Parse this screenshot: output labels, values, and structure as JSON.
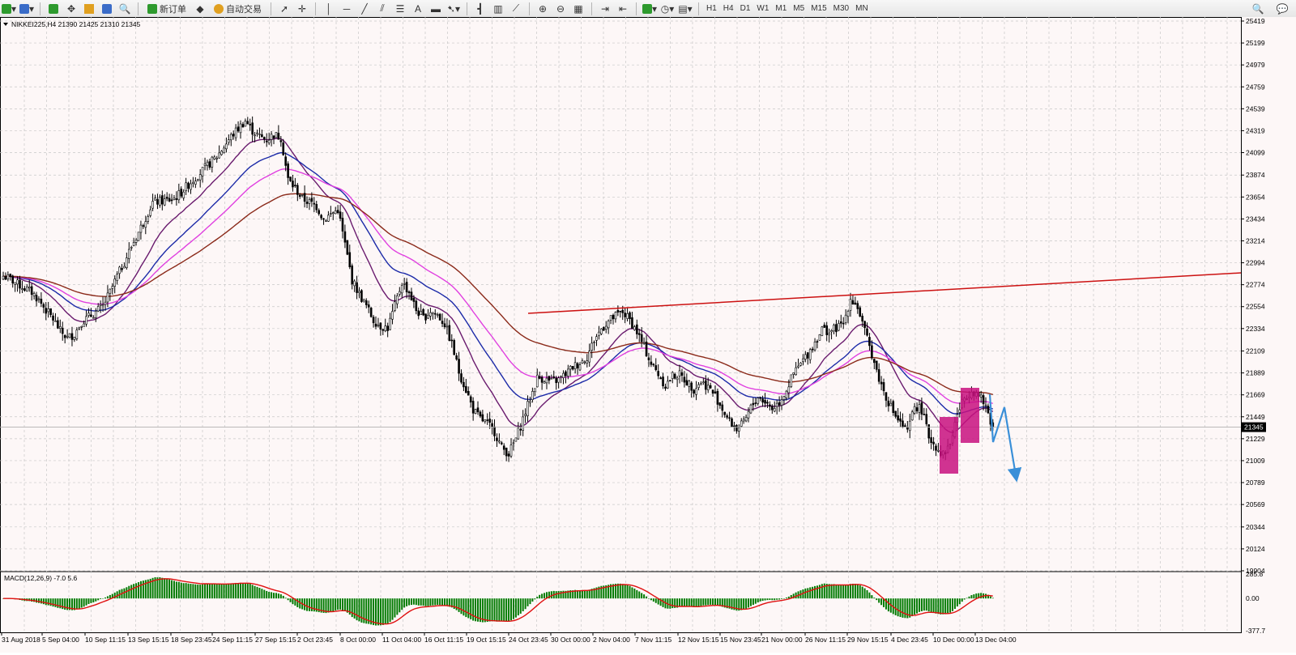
{
  "toolbar": {
    "new_order_label": "新订单",
    "auto_trading_label": "自动交易",
    "timeframes": [
      "H1",
      "H4",
      "D1",
      "W1",
      "M1",
      "M5",
      "M15",
      "M30",
      "MN"
    ],
    "icons": [
      "new-chart-icon",
      "profiles-icon",
      "market-watch-icon",
      "navigator-icon",
      "data-window-icon",
      "terminal-icon",
      "strategy-tester-icon",
      "new-order-icon",
      "meta-editor-icon",
      "auto-trading-icon",
      "cursor-icon",
      "crosshair-icon",
      "vertical-line-icon",
      "horizontal-line-icon",
      "trendline-icon",
      "equidistant-channel-icon",
      "fibonacci-icon",
      "text-icon",
      "label-icon",
      "arrows-icon",
      "bar-chart-icon",
      "candlestick-icon",
      "line-chart-icon",
      "zoom-in-icon",
      "zoom-out-icon",
      "tile-windows-icon",
      "chart-shift-icon",
      "autoscroll-icon",
      "indicators-icon",
      "periods-icon",
      "templates-icon",
      "search-icon",
      "chat-icon"
    ]
  },
  "chart": {
    "header": "NIKKEI225,H4  21390 21425 21310 21345",
    "price_ticks": [
      "25419",
      "25199",
      "24979",
      "24759",
      "24539",
      "24319",
      "24099",
      "23874",
      "23654",
      "23434",
      "23214",
      "22994",
      "22774",
      "22554",
      "22334",
      "22109",
      "21889",
      "21669",
      "21449",
      "21229",
      "21009",
      "20789",
      "20569",
      "20344",
      "20124",
      "19904"
    ],
    "current_price": "21345",
    "time_ticks": [
      "31 Aug 2018",
      "5 Sep 04:00",
      "10 Sep 11:15",
      "13 Sep 15:15",
      "18 Sep 23:45",
      "24 Sep 11:15",
      "27 Sep 15:15",
      "2 Oct 23:45",
      "8 Oct 00:00",
      "11 Oct 04:00",
      "16 Oct 11:15",
      "19 Oct 15:15",
      "24 Oct 23:45",
      "30 Oct 00:00",
      "2 Nov 04:00",
      "7 Nov 11:15",
      "12 Nov 15:15",
      "15 Nov 23:45",
      "21 Nov 00:00",
      "26 Nov 11:15",
      "29 Nov 15:15",
      "4 Dec 23:45",
      "10 Dec 00:00",
      "13 Dec 04:00"
    ],
    "macd_label": "MACD(12,26,9) -7.0 5.6",
    "macd_ticks": [
      "285.8",
      "0.00",
      "-377.7"
    ],
    "colors": {
      "background": "#fdf7f7",
      "grid": "#c8c8c8",
      "candle": "#000000",
      "ma_purple": "#6a1b6e",
      "ma_blue": "#1c2aa8",
      "ma_magenta": "#e040e0",
      "ma_brown": "#8b2a1a",
      "trendline": "#cc1111",
      "box": "#c8107f",
      "arrow": "#3a8fd8",
      "histogram": "#007a00",
      "signal": "#e01010"
    }
  },
  "chart_data": {
    "type": "candlestick",
    "symbol": "NIKKEI225",
    "timeframe": "H4",
    "last_bar": {
      "open": 21390,
      "high": 21425,
      "low": 21310,
      "close": 21345
    },
    "ylim": [
      19904,
      25419
    ],
    "x_time_labels": [
      "31 Aug 2018",
      "5 Sep 04:00",
      "10 Sep 11:15",
      "13 Sep 15:15",
      "18 Sep 23:45",
      "24 Sep 11:15",
      "27 Sep 15:15",
      "2 Oct 23:45",
      "8 Oct 00:00",
      "11 Oct 04:00",
      "16 Oct 11:15",
      "19 Oct 15:15",
      "24 Oct 23:45",
      "30 Oct 00:00",
      "2 Nov 04:00",
      "7 Nov 11:15",
      "12 Nov 15:15",
      "15 Nov 23:45",
      "21 Nov 00:00",
      "26 Nov 11:15",
      "29 Nov 15:15",
      "4 Dec 23:45",
      "10 Dec 00:00",
      "13 Dec 04:00"
    ],
    "close_path": [
      [
        0,
        22860
      ],
      [
        3,
        22830
      ],
      [
        6,
        22780
      ],
      [
        9,
        22740
      ],
      [
        12,
        22700
      ],
      [
        15,
        22620
      ],
      [
        18,
        22520
      ],
      [
        21,
        22430
      ],
      [
        24,
        22310
      ],
      [
        27,
        22240
      ],
      [
        30,
        22280
      ],
      [
        33,
        22400
      ],
      [
        36,
        22450
      ],
      [
        39,
        22500
      ],
      [
        42,
        22560
      ],
      [
        45,
        22700
      ],
      [
        48,
        22860
      ],
      [
        51,
        23000
      ],
      [
        54,
        23160
      ],
      [
        57,
        23300
      ],
      [
        60,
        23450
      ],
      [
        63,
        23600
      ],
      [
        66,
        23610
      ],
      [
        69,
        23620
      ],
      [
        72,
        23640
      ],
      [
        75,
        23700
      ],
      [
        78,
        23780
      ],
      [
        81,
        23850
      ],
      [
        84,
        23920
      ],
      [
        87,
        23990
      ],
      [
        90,
        24060
      ],
      [
        93,
        24160
      ],
      [
        96,
        24260
      ],
      [
        99,
        24340
      ],
      [
        102,
        24420
      ],
      [
        105,
        24320
      ],
      [
        108,
        24260
      ],
      [
        111,
        24230
      ],
      [
        114,
        24280
      ],
      [
        117,
        24250
      ],
      [
        120,
        23830
      ],
      [
        123,
        23740
      ],
      [
        126,
        23640
      ],
      [
        129,
        23600
      ],
      [
        132,
        23560
      ],
      [
        135,
        23430
      ],
      [
        138,
        23480
      ],
      [
        141,
        23530
      ],
      [
        144,
        23180
      ],
      [
        147,
        22820
      ],
      [
        150,
        22680
      ],
      [
        153,
        22560
      ],
      [
        156,
        22420
      ],
      [
        159,
        22360
      ],
      [
        162,
        22340
      ],
      [
        165,
        22560
      ],
      [
        168,
        22800
      ],
      [
        171,
        22700
      ],
      [
        174,
        22520
      ],
      [
        177,
        22440
      ],
      [
        180,
        22510
      ],
      [
        183,
        22470
      ],
      [
        186,
        22380
      ],
      [
        189,
        22180
      ],
      [
        192,
        21900
      ],
      [
        195,
        21720
      ],
      [
        198,
        21520
      ],
      [
        201,
        21430
      ],
      [
        204,
        21380
      ],
      [
        207,
        21300
      ],
      [
        210,
        21140
      ],
      [
        213,
        21080
      ],
      [
        216,
        21230
      ],
      [
        219,
        21430
      ],
      [
        222,
        21630
      ],
      [
        225,
        21840
      ],
      [
        228,
        21830
      ],
      [
        231,
        21800
      ],
      [
        234,
        21820
      ],
      [
        237,
        21880
      ],
      [
        240,
        21950
      ],
      [
        243,
        21990
      ],
      [
        246,
        22050
      ],
      [
        249,
        22220
      ],
      [
        252,
        22330
      ],
      [
        255,
        22410
      ],
      [
        258,
        22460
      ],
      [
        261,
        22500
      ],
      [
        264,
        22420
      ],
      [
        267,
        22300
      ],
      [
        270,
        22150
      ],
      [
        273,
        21980
      ],
      [
        276,
        21880
      ],
      [
        279,
        21760
      ],
      [
        282,
        21860
      ],
      [
        285,
        21870
      ],
      [
        288,
        21800
      ],
      [
        291,
        21730
      ],
      [
        294,
        21800
      ],
      [
        297,
        21750
      ],
      [
        300,
        21660
      ],
      [
        303,
        21530
      ],
      [
        306,
        21400
      ],
      [
        309,
        21330
      ],
      [
        312,
        21380
      ],
      [
        315,
        21540
      ],
      [
        318,
        21650
      ],
      [
        321,
        21600
      ],
      [
        324,
        21530
      ],
      [
        327,
        21600
      ],
      [
        330,
        21720
      ],
      [
        333,
        21880
      ],
      [
        336,
        21980
      ],
      [
        339,
        22080
      ],
      [
        342,
        22200
      ],
      [
        345,
        22330
      ],
      [
        348,
        22300
      ],
      [
        351,
        22340
      ],
      [
        354,
        22380
      ],
      [
        357,
        22640
      ],
      [
        360,
        22550
      ],
      [
        363,
        22300
      ],
      [
        366,
        22080
      ],
      [
        369,
        21830
      ],
      [
        372,
        21650
      ],
      [
        375,
        21500
      ],
      [
        378,
        21380
      ],
      [
        381,
        21290
      ],
      [
        384,
        21560
      ],
      [
        387,
        21520
      ],
      [
        390,
        21250
      ],
      [
        393,
        21150
      ],
      [
        396,
        21070
      ],
      [
        399,
        21180
      ],
      [
        402,
        21480
      ],
      [
        405,
        21640
      ],
      [
        408,
        21720
      ],
      [
        411,
        21660
      ],
      [
        414,
        21550
      ],
      [
        417,
        21345
      ]
    ],
    "indicator": {
      "name": "MACD(12,26,9)",
      "main": -7.0,
      "signal": 5.6,
      "ylim": [
        -377.7,
        285.8
      ]
    }
  }
}
